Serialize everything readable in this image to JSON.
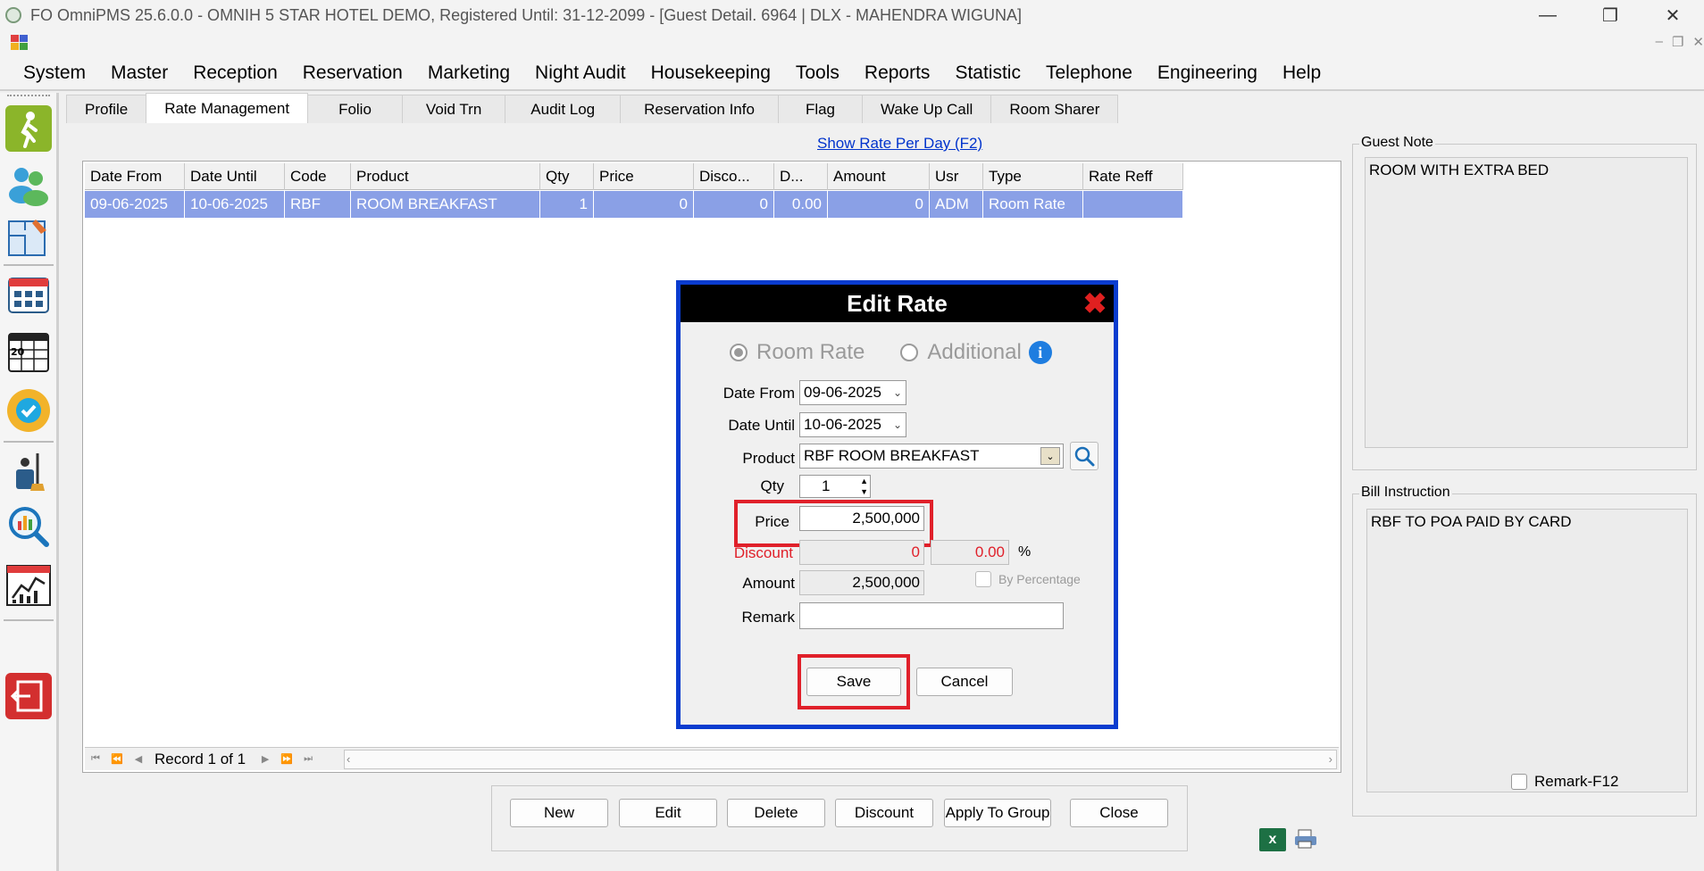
{
  "window": {
    "title": "FO OmniPMS 25.6.0.0 - OMNIH 5 STAR HOTEL DEMO, Registered Until: 31-12-2099 - [Guest Detail. 6964 | DLX - MAHENDRA WIGUNA]",
    "minimize": "—",
    "maximize": "❐",
    "close": "✕"
  },
  "menu": [
    "System",
    "Master",
    "Reception",
    "Reservation",
    "Marketing",
    "Night Audit",
    "Housekeeping",
    "Tools",
    "Reports",
    "Statistic",
    "Telephone",
    "Engineering",
    "Help"
  ],
  "tabs": [
    "Profile",
    "Rate Management",
    "Folio",
    "Void Trn",
    "Audit Log",
    "Reservation Info",
    "Flag",
    "Wake Up Call",
    "Room Sharer"
  ],
  "active_tab": "Rate Management",
  "show_rate_link": "Show Rate Per Day (F2)",
  "grid": {
    "columns": [
      "Date From",
      "Date Until",
      "Code",
      "Product",
      "Qty",
      "Price",
      "Disco...",
      "D...",
      "Amount",
      "Usr",
      "Type",
      "Rate Reff"
    ],
    "rows": [
      [
        "09-06-2025",
        "10-06-2025",
        "RBF",
        "ROOM BREAKFAST",
        "1",
        "0",
        "0",
        "0.00",
        "0",
        "ADM",
        "Room Rate",
        ""
      ]
    ],
    "record_label": "Record 1 of 1"
  },
  "guest_note": {
    "label": "Guest Note",
    "text": "ROOM WITH EXTRA BED"
  },
  "bill_instruction": {
    "label": "Bill Instruction",
    "text": "RBF TO POA PAID BY CARD",
    "remark_label": "Remark-F12"
  },
  "actions": [
    "New",
    "Edit",
    "Delete",
    "Discount",
    "Apply To Group",
    "Close"
  ],
  "dialog": {
    "title": "Edit Rate",
    "radio_room_rate": "Room Rate",
    "radio_additional": "Additional",
    "date_from_label": "Date From",
    "date_from": "09-06-2025",
    "date_until_label": "Date Until",
    "date_until": "10-06-2025",
    "product_label": "Product",
    "product": "RBF ROOM BREAKFAST",
    "qty_label": "Qty",
    "qty": "1",
    "price_label": "Price",
    "price": "2,500,000",
    "discount_label": "Discount",
    "discount": "0",
    "discount_pct": "0.00",
    "pct_sign": "%",
    "by_percentage": "By Percentage",
    "amount_label": "Amount",
    "amount": "2,500,000",
    "remark_label": "Remark",
    "remark": "",
    "save": "Save",
    "cancel": "Cancel"
  },
  "colors": {
    "dialog_border": "#0a3ccf",
    "highlight": "#e0202a",
    "selected_row": "#8aa0e6",
    "link": "#0033cc"
  }
}
